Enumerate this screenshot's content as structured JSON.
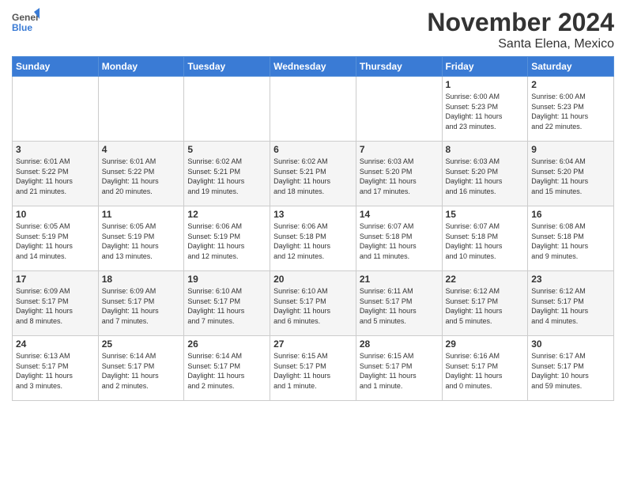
{
  "header": {
    "logo_general": "General",
    "logo_blue": "Blue",
    "month_title": "November 2024",
    "location": "Santa Elena, Mexico"
  },
  "days_of_week": [
    "Sunday",
    "Monday",
    "Tuesday",
    "Wednesday",
    "Thursday",
    "Friday",
    "Saturday"
  ],
  "weeks": [
    [
      {
        "day": "",
        "info": ""
      },
      {
        "day": "",
        "info": ""
      },
      {
        "day": "",
        "info": ""
      },
      {
        "day": "",
        "info": ""
      },
      {
        "day": "",
        "info": ""
      },
      {
        "day": "1",
        "info": "Sunrise: 6:00 AM\nSunset: 5:23 PM\nDaylight: 11 hours\nand 23 minutes."
      },
      {
        "day": "2",
        "info": "Sunrise: 6:00 AM\nSunset: 5:23 PM\nDaylight: 11 hours\nand 22 minutes."
      }
    ],
    [
      {
        "day": "3",
        "info": "Sunrise: 6:01 AM\nSunset: 5:22 PM\nDaylight: 11 hours\nand 21 minutes."
      },
      {
        "day": "4",
        "info": "Sunrise: 6:01 AM\nSunset: 5:22 PM\nDaylight: 11 hours\nand 20 minutes."
      },
      {
        "day": "5",
        "info": "Sunrise: 6:02 AM\nSunset: 5:21 PM\nDaylight: 11 hours\nand 19 minutes."
      },
      {
        "day": "6",
        "info": "Sunrise: 6:02 AM\nSunset: 5:21 PM\nDaylight: 11 hours\nand 18 minutes."
      },
      {
        "day": "7",
        "info": "Sunrise: 6:03 AM\nSunset: 5:20 PM\nDaylight: 11 hours\nand 17 minutes."
      },
      {
        "day": "8",
        "info": "Sunrise: 6:03 AM\nSunset: 5:20 PM\nDaylight: 11 hours\nand 16 minutes."
      },
      {
        "day": "9",
        "info": "Sunrise: 6:04 AM\nSunset: 5:20 PM\nDaylight: 11 hours\nand 15 minutes."
      }
    ],
    [
      {
        "day": "10",
        "info": "Sunrise: 6:05 AM\nSunset: 5:19 PM\nDaylight: 11 hours\nand 14 minutes."
      },
      {
        "day": "11",
        "info": "Sunrise: 6:05 AM\nSunset: 5:19 PM\nDaylight: 11 hours\nand 13 minutes."
      },
      {
        "day": "12",
        "info": "Sunrise: 6:06 AM\nSunset: 5:19 PM\nDaylight: 11 hours\nand 12 minutes."
      },
      {
        "day": "13",
        "info": "Sunrise: 6:06 AM\nSunset: 5:18 PM\nDaylight: 11 hours\nand 12 minutes."
      },
      {
        "day": "14",
        "info": "Sunrise: 6:07 AM\nSunset: 5:18 PM\nDaylight: 11 hours\nand 11 minutes."
      },
      {
        "day": "15",
        "info": "Sunrise: 6:07 AM\nSunset: 5:18 PM\nDaylight: 11 hours\nand 10 minutes."
      },
      {
        "day": "16",
        "info": "Sunrise: 6:08 AM\nSunset: 5:18 PM\nDaylight: 11 hours\nand 9 minutes."
      }
    ],
    [
      {
        "day": "17",
        "info": "Sunrise: 6:09 AM\nSunset: 5:17 PM\nDaylight: 11 hours\nand 8 minutes."
      },
      {
        "day": "18",
        "info": "Sunrise: 6:09 AM\nSunset: 5:17 PM\nDaylight: 11 hours\nand 7 minutes."
      },
      {
        "day": "19",
        "info": "Sunrise: 6:10 AM\nSunset: 5:17 PM\nDaylight: 11 hours\nand 7 minutes."
      },
      {
        "day": "20",
        "info": "Sunrise: 6:10 AM\nSunset: 5:17 PM\nDaylight: 11 hours\nand 6 minutes."
      },
      {
        "day": "21",
        "info": "Sunrise: 6:11 AM\nSunset: 5:17 PM\nDaylight: 11 hours\nand 5 minutes."
      },
      {
        "day": "22",
        "info": "Sunrise: 6:12 AM\nSunset: 5:17 PM\nDaylight: 11 hours\nand 5 minutes."
      },
      {
        "day": "23",
        "info": "Sunrise: 6:12 AM\nSunset: 5:17 PM\nDaylight: 11 hours\nand 4 minutes."
      }
    ],
    [
      {
        "day": "24",
        "info": "Sunrise: 6:13 AM\nSunset: 5:17 PM\nDaylight: 11 hours\nand 3 minutes."
      },
      {
        "day": "25",
        "info": "Sunrise: 6:14 AM\nSunset: 5:17 PM\nDaylight: 11 hours\nand 2 minutes."
      },
      {
        "day": "26",
        "info": "Sunrise: 6:14 AM\nSunset: 5:17 PM\nDaylight: 11 hours\nand 2 minutes."
      },
      {
        "day": "27",
        "info": "Sunrise: 6:15 AM\nSunset: 5:17 PM\nDaylight: 11 hours\nand 1 minute."
      },
      {
        "day": "28",
        "info": "Sunrise: 6:15 AM\nSunset: 5:17 PM\nDaylight: 11 hours\nand 1 minute."
      },
      {
        "day": "29",
        "info": "Sunrise: 6:16 AM\nSunset: 5:17 PM\nDaylight: 11 hours\nand 0 minutes."
      },
      {
        "day": "30",
        "info": "Sunrise: 6:17 AM\nSunset: 5:17 PM\nDaylight: 10 hours\nand 59 minutes."
      }
    ]
  ]
}
